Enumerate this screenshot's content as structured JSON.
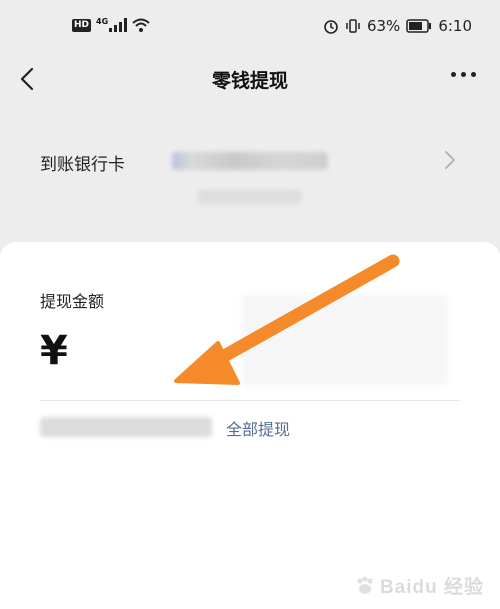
{
  "status_bar": {
    "hd_label": "HD",
    "network_label": "4G",
    "battery_percent": "63%",
    "time": "6:10",
    "icons": [
      "signal-icon",
      "wifi-icon",
      "alarm-icon",
      "vibrate-icon",
      "battery-icon"
    ]
  },
  "nav": {
    "title": "零钱提现",
    "back_icon": "chevron-left-icon",
    "more_icon": "more-icon"
  },
  "bank": {
    "label": "到账银行卡"
  },
  "withdraw": {
    "amount_label": "提现金额",
    "currency_symbol": "¥",
    "withdraw_all_label": "全部提现"
  },
  "annotation": {
    "arrow_color": "#f58a2a"
  },
  "watermark": {
    "text": "Baidu 经验"
  },
  "colors": {
    "page_bg": "#ededed",
    "card_bg": "#ffffff",
    "link": "#576b95"
  }
}
